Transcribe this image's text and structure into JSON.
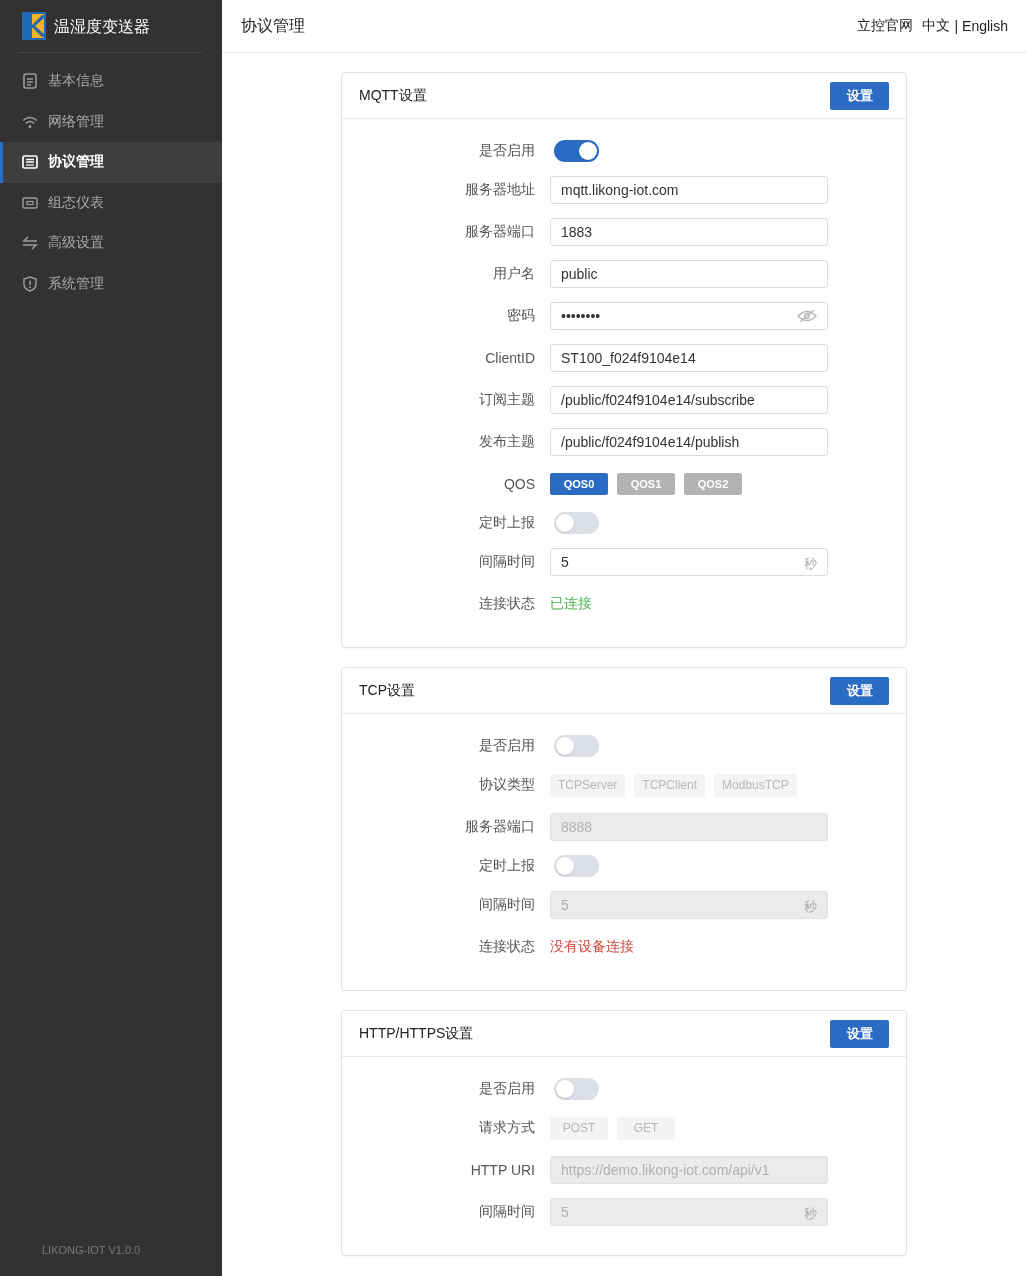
{
  "sidebar": {
    "title": "温湿度变送器",
    "items": [
      {
        "label": "基本信息",
        "selected": false
      },
      {
        "label": "网络管理",
        "selected": false
      },
      {
        "label": "协议管理",
        "selected": true
      },
      {
        "label": "组态仪表",
        "selected": false
      },
      {
        "label": "高级设置",
        "selected": false
      },
      {
        "label": "系统管理",
        "selected": false
      }
    ],
    "version": "LIKONG-IOT V1.0.0"
  },
  "header": {
    "title": "协议管理",
    "website_link": "立控官网",
    "languages": [
      "中文",
      "English"
    ],
    "language_separator": "|"
  },
  "panels": [
    {
      "title": "MQTT设置",
      "button": "设置",
      "rows": [
        {
          "kind": "switch",
          "label": "是否启用",
          "on": true
        },
        {
          "kind": "input",
          "label": "服务器地址",
          "value": "mqtt.likong-iot.com",
          "disabled": false
        },
        {
          "kind": "input",
          "label": "服务器端口",
          "value": "1883",
          "disabled": false
        },
        {
          "kind": "input",
          "label": "用户名",
          "value": "public",
          "disabled": false
        },
        {
          "kind": "password",
          "label": "密码",
          "value": "••••••••",
          "disabled": false
        },
        {
          "kind": "input",
          "label": "ClientID",
          "value": "ST100_f024f9104e14",
          "disabled": false
        },
        {
          "kind": "input",
          "label": "订阅主题",
          "value": "/public/f024f9104e14/subscribe",
          "disabled": false
        },
        {
          "kind": "input",
          "label": "发布主题",
          "value": "/public/f024f9104e14/publish",
          "disabled": false
        },
        {
          "kind": "options",
          "label": "QOS",
          "disabled": false,
          "options": [
            {
              "label": "QOS0",
              "selected": true
            },
            {
              "label": "QOS1",
              "selected": false
            },
            {
              "label": "QOS2",
              "selected": false
            }
          ]
        },
        {
          "kind": "switch",
          "label": "定时上报",
          "on": false
        },
        {
          "kind": "input",
          "label": "间隔时间",
          "value": "5",
          "unit": "秒",
          "disabled": false
        },
        {
          "kind": "status",
          "label": "连接状态",
          "value": "已连接",
          "color": "#4caf50"
        }
      ]
    },
    {
      "title": "TCP设置",
      "button": "设置",
      "rows": [
        {
          "kind": "switch",
          "label": "是否启用",
          "on": false
        },
        {
          "kind": "options",
          "label": "协议类型",
          "disabled": true,
          "options": [
            {
              "label": "TCPServer",
              "selected": false
            },
            {
              "label": "TCPClient",
              "selected": false
            },
            {
              "label": "ModbusTCP",
              "selected": false
            }
          ]
        },
        {
          "kind": "input",
          "label": "服务器端口",
          "value": "8888",
          "disabled": true
        },
        {
          "kind": "switch",
          "label": "定时上报",
          "on": false
        },
        {
          "kind": "input",
          "label": "间隔时间",
          "value": "5",
          "unit": "秒",
          "disabled": true
        },
        {
          "kind": "status",
          "label": "连接状态",
          "value": "没有设备连接",
          "color": "#d2463f"
        }
      ]
    },
    {
      "title": "HTTP/HTTPS设置",
      "button": "设置",
      "rows": [
        {
          "kind": "switch",
          "label": "是否启用",
          "on": false
        },
        {
          "kind": "options",
          "label": "请求方式",
          "disabled": true,
          "options": [
            {
              "label": "POST",
              "selected": false
            },
            {
              "label": "GET",
              "selected": false
            }
          ]
        },
        {
          "kind": "input",
          "label": "HTTP URI",
          "value": "https://demo.likong-iot.com/api/v1",
          "disabled": true
        },
        {
          "kind": "input",
          "label": "间隔时间",
          "value": "5",
          "unit": "秒",
          "disabled": true
        }
      ]
    }
  ]
}
